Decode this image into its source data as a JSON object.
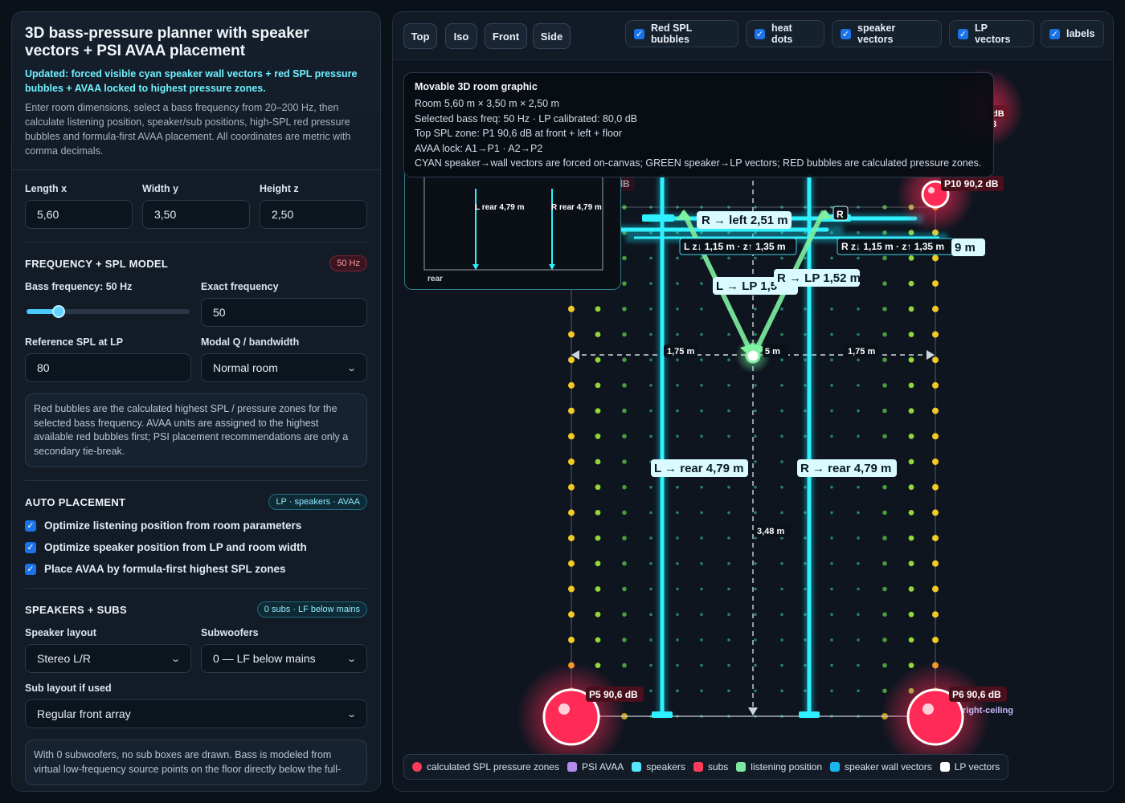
{
  "panel": {
    "title": "3D bass-pressure planner with speaker vectors + PSI AVAA placement",
    "updated": "Updated: forced visible cyan speaker wall vectors + red SPL pressure bubbles + AVAA locked to highest pressure zones.",
    "description": "Enter room dimensions, select a bass frequency from 20–200 Hz, then calculate listening position, speaker/sub positions, high-SPL red pressure bubbles and formula-first AVAA placement. All coordinates are metric with comma decimals.",
    "dims": {
      "length_label": "Length x",
      "length": "5,60",
      "width_label": "Width y",
      "width": "3,50",
      "height_label": "Height z",
      "height": "2,50"
    },
    "freq": {
      "title": "FREQUENCY + SPL MODEL",
      "badge": "50 Hz",
      "slider_label": "Bass frequency: 50 Hz",
      "slider_fraction": 0.167,
      "exact_label": "Exact frequency",
      "exact": "50",
      "ref_label": "Reference SPL at LP",
      "ref": "80",
      "q_label": "Modal Q / bandwidth",
      "q": "Normal room",
      "note": "Red bubbles are the calculated highest SPL / pressure zones for the selected bass frequency. AVAA units are assigned to the highest available red bubbles first; PSI placement recommendations are only a secondary tie-break."
    },
    "auto": {
      "title": "AUTO PLACEMENT",
      "badge": "LP · speakers · AVAA",
      "opt1": "Optimize listening position from room parameters",
      "opt2": "Optimize speaker position from LP and room width",
      "opt3": "Place AVAA by formula-first highest SPL zones"
    },
    "speakers": {
      "title": "SPEAKERS + SUBS",
      "badge": "0 subs · LF below mains",
      "layout_label": "Speaker layout",
      "layout": "Stereo L/R",
      "subs_label": "Subwoofers",
      "subs": "0 — LF below mains",
      "sublayout_label": "Sub layout if used",
      "sublayout": "Regular front array",
      "note": "With 0 subwoofers, no sub boxes are drawn. Bass is modeled from virtual low-frequency source points on the floor directly below the full-"
    }
  },
  "toolbar": {
    "views": [
      "Top",
      "Iso",
      "Front",
      "Side"
    ],
    "toggles": [
      "Red SPL bubbles",
      "heat dots",
      "speaker vectors",
      "LP vectors",
      "labels"
    ]
  },
  "info": {
    "title": "Movable 3D room graphic",
    "lines": [
      "Room 5,60 m × 3,50 m × 2,50 m",
      "Selected bass freq: 50 Hz · LP calibrated: 80,0 dB",
      "Top SPL zone: P1 90,6 dB at front + left + floor",
      "AVAA lock: A1→P1 · A2→P2",
      "CYAN speaker→wall vectors are forced on-canvas; GREEN speaker→LP vectors; RED bubbles are calculated pressure zones."
    ]
  },
  "canvas": {
    "mini_l": "L rear 4,79 m",
    "mini_r": "R rear 4,79 m",
    "mini_rear": "rear",
    "r_left": "R → left 2,51 m",
    "r_tag": "R",
    "lz": "L z↓ 1,15 m · z↑ 1,35 m",
    "rz": "R z↓ 1,15 m · z↑ 1,35 m",
    "l_lp": "L → LP 1,5",
    "r_lp": "R → LP 1,52 m",
    "d_left": "1,75 m",
    "d_right": "1,75 m",
    "d_mid": "5 m",
    "l_rear": "L → rear 4,79 m",
    "r_rear": "R → rear 4,79 m",
    "depth": "3,48 m",
    "p9": "P9 90,2 dB",
    "p10": "P10 90,2 dB",
    "p5": "P5 90,6 dB",
    "p6": "P6 90,6 dB",
    "p_top_right_a": "dB",
    "p_top_right_b": "3",
    "right_ceiling": "right-ceiling",
    "right_9m": "9 m"
  },
  "legend": [
    {
      "label": "calculated SPL pressure zones",
      "color": "#ff3b5c"
    },
    {
      "label": "PSI AVAA",
      "color": "#b48cf0"
    },
    {
      "label": "speakers",
      "color": "#58e6ff"
    },
    {
      "label": "subs",
      "color": "#ff3b5c"
    },
    {
      "label": "listening position",
      "color": "#7ee8a2"
    },
    {
      "label": "speaker wall vectors",
      "color": "#18b6f0"
    },
    {
      "label": "LP vectors",
      "color": "#ffffff"
    }
  ]
}
